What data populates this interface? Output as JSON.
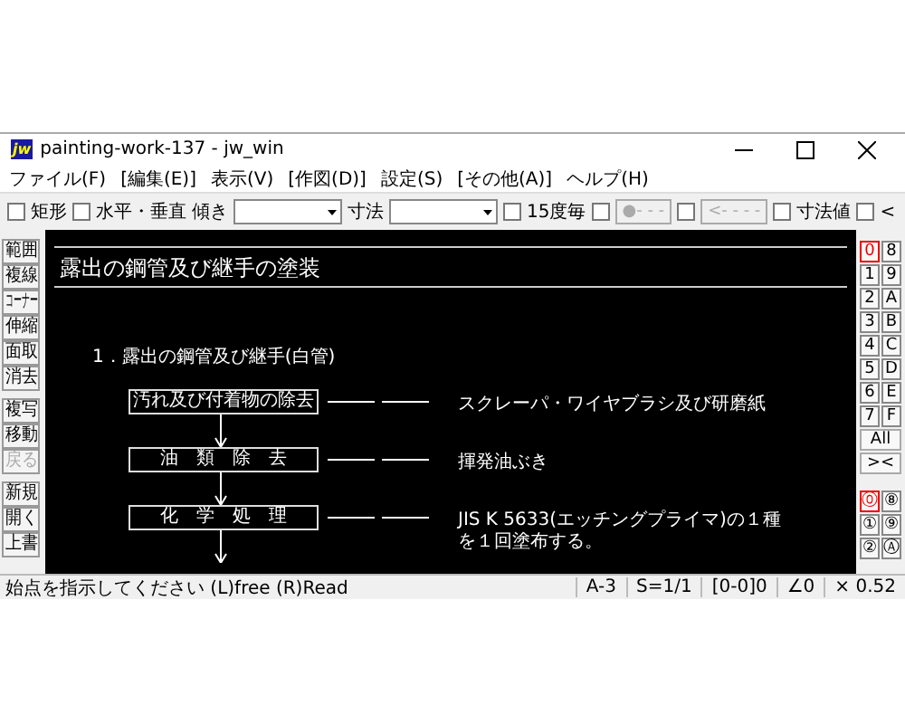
{
  "window": {
    "logo": "jw",
    "title": "painting-work-137 - jw_win"
  },
  "menu": [
    "ファイル(F)",
    "[編集(E)]",
    "表示(V)",
    "[作図(D)]",
    "設定(S)",
    "[その他(A)]",
    "ヘルプ(H)"
  ],
  "toolbar": [
    {
      "kind": "check",
      "label": "矩形",
      "checked": false
    },
    {
      "kind": "check",
      "label": "水平・垂直",
      "checked": false
    },
    {
      "kind": "combo",
      "label": "傾き"
    },
    {
      "kind": "combo",
      "label": "寸法"
    },
    {
      "kind": "check",
      "label": "15度毎",
      "checked": false
    },
    {
      "kind": "checkbutton",
      "label": "●- - -",
      "checked": false,
      "disabled": true
    },
    {
      "kind": "checkbutton",
      "label": "<- - - -",
      "checked": false,
      "disabled": true
    },
    {
      "kind": "check",
      "label": "寸法値",
      "checked": false
    },
    {
      "kind": "check",
      "label": "<",
      "checked": false
    }
  ],
  "tool_groups": [
    [
      {
        "label": "範囲",
        "disabled": false
      },
      {
        "label": "複線",
        "disabled": false
      },
      {
        "label": "コーナー",
        "disabled": false
      },
      {
        "label": "伸縮",
        "disabled": false
      },
      {
        "label": "面取",
        "disabled": false
      },
      {
        "label": "消去",
        "disabled": false
      }
    ],
    [
      {
        "label": "複写",
        "disabled": false
      },
      {
        "label": "移動",
        "disabled": false
      },
      {
        "label": "戻る",
        "disabled": true
      }
    ],
    [
      {
        "label": "新規",
        "disabled": false
      },
      {
        "label": "開く",
        "disabled": false
      },
      {
        "label": "上書",
        "disabled": false
      }
    ]
  ],
  "drawing": {
    "title": "露出の鋼管及び継手の塗装",
    "heading": "1．露出の鋼管及び継手(白管)",
    "steps": [
      {
        "label": "汚れ及び付着物の除去",
        "notes": [
          "スクレーパ・ワイヤブラシ及び研磨紙"
        ]
      },
      {
        "label": "油　類　除　去",
        "notes": [
          "揮発油ぶき"
        ]
      },
      {
        "label": "化　学　処　理",
        "notes": [
          "JIS K 5633(エッチングプライマ)の１種",
          "を１回塗布する。"
        ]
      }
    ]
  },
  "layers": [
    {
      "label": "0",
      "selected": true
    },
    {
      "label": "8",
      "selected": false
    },
    {
      "label": "1",
      "selected": false
    },
    {
      "label": "9",
      "selected": false
    },
    {
      "label": "2",
      "selected": false
    },
    {
      "label": "A",
      "selected": false
    },
    {
      "label": "3",
      "selected": false
    },
    {
      "label": "B",
      "selected": false
    },
    {
      "label": "4",
      "selected": false
    },
    {
      "label": "C",
      "selected": false
    },
    {
      "label": "5",
      "selected": false
    },
    {
      "label": "D",
      "selected": false
    },
    {
      "label": "6",
      "selected": false
    },
    {
      "label": "E",
      "selected": false
    },
    {
      "label": "7",
      "selected": false
    },
    {
      "label": "F",
      "selected": false
    }
  ],
  "layer_buttons": [
    "All",
    "><"
  ],
  "layer_groups": [
    {
      "label": "⓪",
      "selected": true
    },
    {
      "label": "⑧",
      "selected": false
    },
    {
      "label": "①",
      "selected": false
    },
    {
      "label": "⑨",
      "selected": false
    },
    {
      "label": "②",
      "selected": false
    },
    {
      "label": "Ⓐ",
      "selected": false
    }
  ],
  "status_bar": {
    "message": "始点を指示してください (L)free (R)Read",
    "fields": [
      "A-3",
      "S=1/1",
      "[0-0]0",
      "∠0",
      "× 0.52"
    ]
  }
}
